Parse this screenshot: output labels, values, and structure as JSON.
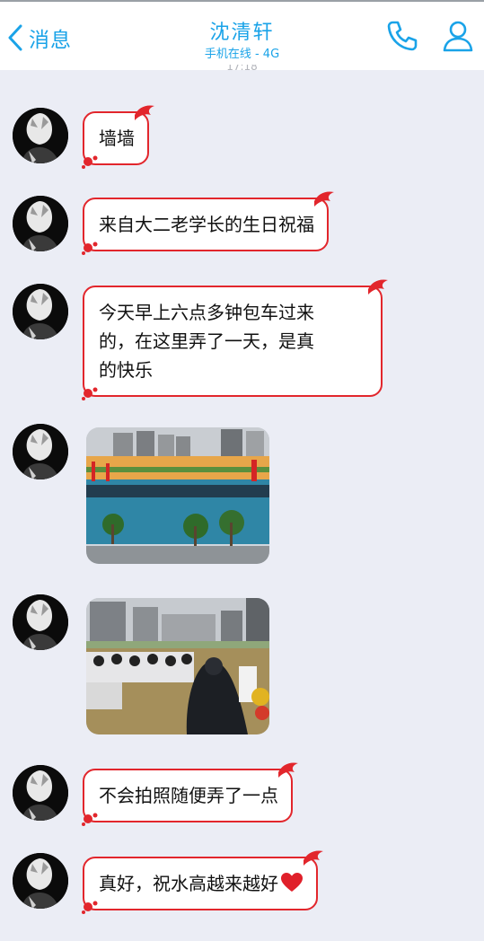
{
  "header": {
    "back_label": "消息",
    "title": "沈清轩",
    "subtitle": "手机在线 - 4G"
  },
  "messages": [
    {
      "type": "text",
      "text": "墙墙"
    },
    {
      "type": "text",
      "text": "来自大二老学长的生日祝福"
    },
    {
      "type": "text",
      "line1": "今天早上六点多钟包车过来",
      "line2": "的，在这里弄了一天，是真",
      "line3": "的快乐"
    },
    {
      "type": "image",
      "subject": "sports-field-ceremony"
    },
    {
      "type": "image",
      "subject": "audience-on-field"
    },
    {
      "type": "text",
      "text": "不会拍照随便弄了一点"
    },
    {
      "type": "text",
      "text": "真好，祝水高越来越好",
      "emoji": "red-heart"
    }
  ],
  "colors": {
    "accent": "#1aa3e8",
    "bubble_border": "#e2262c",
    "background": "#ebedf5"
  },
  "icons": [
    "chevron-left-icon",
    "phone-icon",
    "contact-icon",
    "avatar",
    "red-heart-icon"
  ]
}
